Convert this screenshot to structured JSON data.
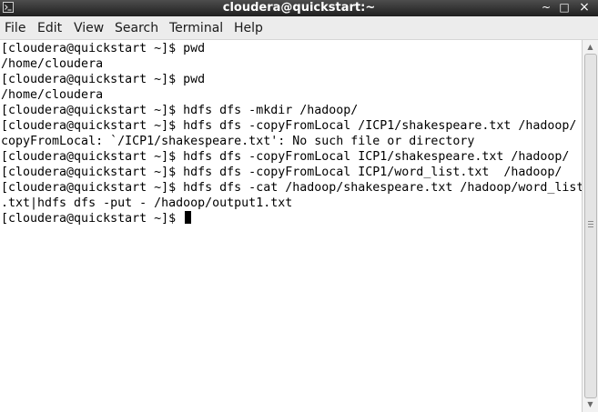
{
  "window": {
    "title": "cloudera@quickstart:~",
    "minimize_label": "~",
    "maximize_label": "□",
    "close_label": "×"
  },
  "menu": {
    "items": [
      "File",
      "Edit",
      "View",
      "Search",
      "Terminal",
      "Help"
    ]
  },
  "terminal": {
    "lines": [
      "[cloudera@quickstart ~]$ pwd",
      "/home/cloudera",
      "[cloudera@quickstart ~]$ pwd",
      "/home/cloudera",
      "[cloudera@quickstart ~]$ hdfs dfs -mkdir /hadoop/",
      "[cloudera@quickstart ~]$ hdfs dfs -copyFromLocal /ICP1/shakespeare.txt /hadoop/",
      "copyFromLocal: `/ICP1/shakespeare.txt': No such file or directory",
      "[cloudera@quickstart ~]$ hdfs dfs -copyFromLocal ICP1/shakespeare.txt /hadoop/",
      "[cloudera@quickstart ~]$ hdfs dfs -copyFromLocal ICP1/word_list.txt  /hadoop/",
      "[cloudera@quickstart ~]$ hdfs dfs -cat /hadoop/shakespeare.txt /hadoop/word_list",
      ".txt|hdfs dfs -put - /hadoop/output1.txt"
    ],
    "prompt": "[cloudera@quickstart ~]$ "
  },
  "icons": {
    "app": "terminal-icon",
    "scroll_up": "scroll-up-arrow-icon",
    "scroll_down": "scroll-down-arrow-icon"
  }
}
